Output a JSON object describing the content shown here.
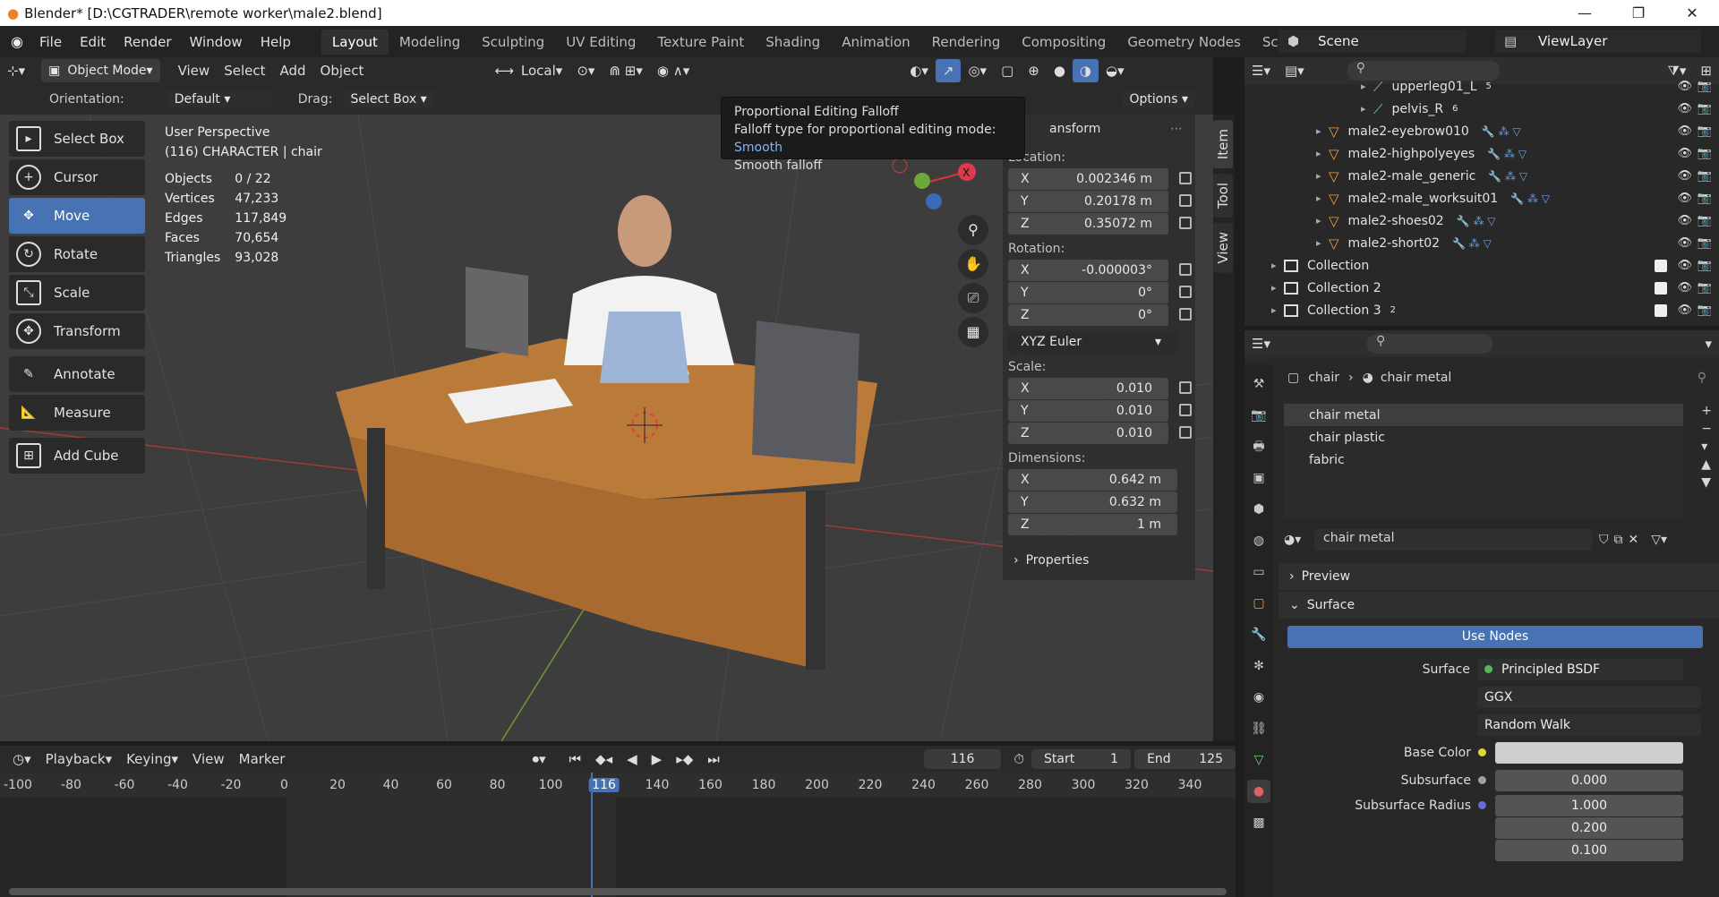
{
  "window": {
    "title": "Blender* [D:\\CGTRADER\\remote worker\\male2.blend]",
    "minimize": "—",
    "maximize": "❐",
    "close": "✕"
  },
  "menu": [
    "File",
    "Edit",
    "Render",
    "Window",
    "Help"
  ],
  "workspaces": [
    "Layout",
    "Modeling",
    "Sculpting",
    "UV Editing",
    "Texture Paint",
    "Shading",
    "Animation",
    "Rendering",
    "Compositing",
    "Geometry Nodes",
    "Scripting"
  ],
  "add_workspace": "+",
  "scene": {
    "name": "Scene",
    "view_layer": "ViewLayer"
  },
  "viewport_header": {
    "mode": "Object Mode",
    "menus": [
      "View",
      "Select",
      "Add",
      "Object"
    ],
    "transform_orientation": "Local"
  },
  "tool_options": {
    "orientation_label": "Orientation:",
    "orientation": "Default",
    "drag_label": "Drag:",
    "drag": "Select Box",
    "options": "Options"
  },
  "tools": [
    "Select Box",
    "Cursor",
    "Move",
    "Rotate",
    "Scale",
    "Transform",
    "Annotate",
    "Measure",
    "Add Cube"
  ],
  "overlay": {
    "perspective": "User Perspective",
    "collection": "(116) CHARACTER | chair"
  },
  "stats": [
    {
      "k": "Objects",
      "v": "0 / 22"
    },
    {
      "k": "Vertices",
      "v": "47,233"
    },
    {
      "k": "Edges",
      "v": "117,849"
    },
    {
      "k": "Faces",
      "v": "70,654"
    },
    {
      "k": "Triangles",
      "v": "93,028"
    }
  ],
  "tooltip": {
    "title": "Proportional Editing Falloff",
    "line": "Falloff type for proportional editing mode:",
    "value": "Smooth",
    "desc": "Smooth falloff"
  },
  "npanel": {
    "header": "ansform",
    "location_label": "Location:",
    "location": [
      "0.002346 m",
      "0.20178 m",
      "0.35072 m"
    ],
    "rotation_label": "Rotation:",
    "rotation": [
      "-0.000003°",
      "0°",
      "0°"
    ],
    "rotation_mode": "XYZ Euler",
    "scale_label": "Scale:",
    "scale": [
      "0.010",
      "0.010",
      "0.010"
    ],
    "dimensions_label": "Dimensions:",
    "dimensions": [
      "0.642 m",
      "0.632 m",
      "1 m"
    ],
    "axes": [
      "X",
      "Y",
      "Z"
    ],
    "properties": "Properties"
  },
  "npanel_tabs": [
    "Item",
    "Tool",
    "View"
  ],
  "timeline": {
    "menus": [
      "Playback",
      "Keying",
      "View",
      "Marker"
    ],
    "current": "116",
    "start_label": "Start",
    "start": "1",
    "end_label": "End",
    "end": "125",
    "ticks": [
      "-100",
      "-80",
      "-60",
      "-40",
      "-20",
      "0",
      "20",
      "40",
      "60",
      "80",
      "100",
      "116",
      "140",
      "160",
      "180",
      "200",
      "220",
      "240",
      "260",
      "280",
      "300",
      "320",
      "340"
    ]
  },
  "outliner": {
    "rows": [
      {
        "name": "upperleg01_L",
        "badge": "5",
        "type": "bone"
      },
      {
        "name": "pelvis_R",
        "badge": "6",
        "type": "bone"
      },
      {
        "name": "male2-eyebrow010",
        "type": "obj"
      },
      {
        "name": "male2-highpolyeyes",
        "type": "obj"
      },
      {
        "name": "male2-male_generic",
        "type": "obj"
      },
      {
        "name": "male2-male_worksuit01",
        "type": "obj"
      },
      {
        "name": "male2-shoes02",
        "type": "obj"
      },
      {
        "name": "male2-short02",
        "type": "obj"
      },
      {
        "name": "Collection",
        "type": "col"
      },
      {
        "name": "Collection 2",
        "type": "col"
      },
      {
        "name": "Collection 3",
        "type": "col",
        "badge": "2"
      }
    ]
  },
  "properties": {
    "breadcrumb_object": "chair",
    "breadcrumb_material": "chair metal",
    "slots": [
      "chair metal",
      "chair plastic",
      "fabric"
    ],
    "material": "chair metal",
    "panels": {
      "preview": "Preview",
      "surface": "Surface"
    },
    "use_nodes": "Use Nodes",
    "rows": [
      {
        "label": "Surface",
        "value": "Principled BSDF",
        "dot": "#53b85b"
      },
      {
        "label": "",
        "value": "GGX"
      },
      {
        "label": "",
        "value": "Random Walk"
      },
      {
        "label": "Base Color",
        "value": "",
        "dot": "#e3d33a"
      },
      {
        "label": "Subsurface",
        "value": "0.000",
        "dot": "#a0a0a0"
      },
      {
        "label": "Subsurface Radius",
        "value": "1.000",
        "dot": "#6a6ad6"
      },
      {
        "label": "",
        "value": "0.200"
      },
      {
        "label": "",
        "value": "0.100"
      }
    ]
  },
  "colors": {
    "accent": "#4772b3",
    "header": "#2a2a2a",
    "viewport": "#3d3d3d"
  }
}
